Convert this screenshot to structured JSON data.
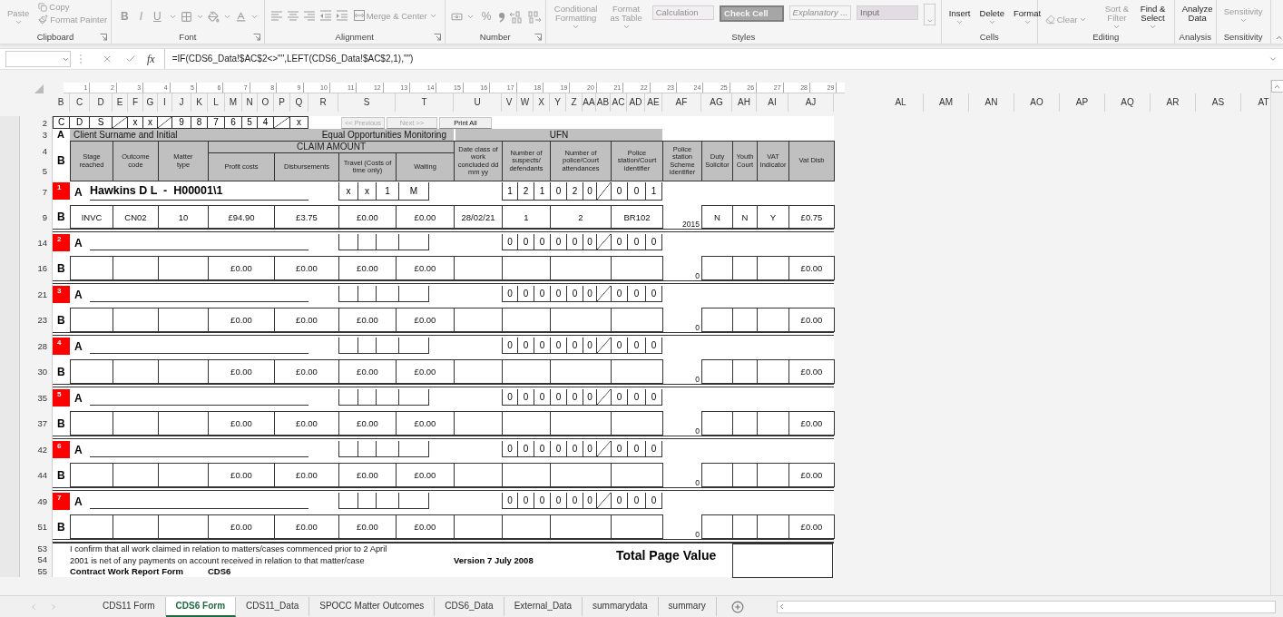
{
  "ribbon": {
    "groups": [
      {
        "kind": "clipboard",
        "label": "Clipboard",
        "buttons": [
          {
            "label": "Paste",
            "disabled": true
          },
          {
            "label": "Copy",
            "disabled": true
          },
          {
            "label": "Format Painter",
            "disabled": true
          }
        ]
      },
      {
        "kind": "font",
        "label": "Font",
        "buttons": [
          {
            "label": "B",
            "disabled": true
          },
          {
            "label": "I",
            "disabled": true
          },
          {
            "label": "U",
            "disabled": true
          }
        ]
      },
      {
        "kind": "alignment",
        "label": "Alignment",
        "buttons": [
          {
            "label": "Merge & Center",
            "disabled": true
          }
        ]
      },
      {
        "kind": "number",
        "label": "Number",
        "buttons": [
          {
            "label": "%",
            "disabled": true
          }
        ]
      },
      {
        "kind": "styles",
        "label": "Styles",
        "buttons": [
          {
            "label": "Conditional Formatting",
            "disabled": true
          },
          {
            "label": "Format as Table",
            "disabled": true
          }
        ],
        "styles": [
          {
            "label": "Calculation",
            "kind": "calc"
          },
          {
            "label": "Check Cell",
            "kind": "check"
          },
          {
            "label": "Explanatory ...",
            "kind": "note"
          },
          {
            "label": "Input",
            "kind": "input"
          }
        ]
      },
      {
        "kind": "cells",
        "label": "Cells",
        "buttons": [
          {
            "label": "Insert",
            "disabled": false
          },
          {
            "label": "Delete",
            "disabled": false
          },
          {
            "label": "Format",
            "disabled": false
          }
        ]
      },
      {
        "kind": "editing",
        "label": "Editing",
        "buttons": [
          {
            "label": "Clear",
            "disabled": true
          },
          {
            "label": "Sort & Filter",
            "disabled": true
          },
          {
            "label": "Find & Select",
            "disabled": false
          }
        ]
      },
      {
        "kind": "analysis",
        "label": "Analysis",
        "buttons": [
          {
            "label": "Analyze Data",
            "disabled": false
          }
        ]
      },
      {
        "kind": "sensitivity",
        "label": "Sensitivity",
        "buttons": [
          {
            "label": "Sensitivity",
            "disabled": true
          }
        ]
      }
    ]
  },
  "formula_bar": {
    "function_label": "fx",
    "formula": "=IF(CDS6_Data!$AC$2<>\"\",LEFT(CDS6_Data!$AC$2,1),\"\")"
  },
  "ruler": [
    "1",
    "2",
    "3",
    "4",
    "5",
    "6",
    "7",
    "8",
    "9",
    "10",
    "11",
    "12",
    "13",
    "14",
    "15",
    "16",
    "17",
    "18",
    "19",
    "20",
    "21",
    "22",
    "23",
    "24",
    "25",
    "26",
    "27",
    "28",
    "29"
  ],
  "columns": [
    "B",
    "C",
    "D",
    "E",
    "F",
    "G",
    "I",
    "J",
    "K",
    "L",
    "M",
    "N",
    "O",
    "P",
    "Q",
    "R",
    "S",
    "T",
    "U",
    "V",
    "W",
    "X",
    "Y",
    "Z",
    "AA",
    "AB",
    "AC",
    "AD",
    "AE",
    "AF",
    "AG",
    "AH",
    "AI",
    "AJ"
  ],
  "right_columns": [
    "AL",
    "AM",
    "AN",
    "AO",
    "AP",
    "AQ",
    "AR",
    "AS",
    "AT"
  ],
  "sheet": {
    "code_row": {
      "row": "2",
      "cells": [
        {
          "kind": "text",
          "text": "C"
        },
        {
          "kind": "text",
          "text": "D"
        },
        {
          "kind": "text",
          "text": "S"
        },
        {
          "kind": "slash"
        },
        {
          "kind": "text",
          "text": "x"
        },
        {
          "kind": "text",
          "text": "x"
        },
        {
          "kind": "slash"
        },
        {
          "kind": "text",
          "text": "9"
        },
        {
          "kind": "text",
          "text": "8"
        },
        {
          "kind": "text",
          "text": "7"
        },
        {
          "kind": "text",
          "text": "6"
        },
        {
          "kind": "text",
          "text": "5"
        },
        {
          "kind": "text",
          "text": "4"
        },
        {
          "kind": "slash"
        },
        {
          "kind": "text",
          "text": "x"
        }
      ],
      "buttons": [
        {
          "label": "<< Previous",
          "disabled": true
        },
        {
          "label": "Next >>",
          "disabled": true
        },
        {
          "label": "Print All",
          "disabled": false
        }
      ]
    },
    "band_row": {
      "row": "3",
      "label": "A",
      "client": "Client Surname and Initial",
      "monitoring": "Equal Opportunities Monitoring",
      "ufn": "UFN"
    },
    "header": {
      "rows": [
        "4",
        "5"
      ],
      "label": "B",
      "claim": "CLAIM AMOUNT",
      "columns": [
        "Stage reached",
        "Outcome code",
        "Matter type",
        "Profit costs",
        "Disbursements",
        "Travel (Costs of time only)",
        "Waiting",
        "Date class of work concluded dd mm yy",
        "Number of suspects/ defendants",
        "Number of police/Court attendances",
        "Police station/Court identifier",
        "Police station Scheme identifier",
        "Duty Solicitor",
        "Youth Court",
        "VAT Indicator",
        "Vat Disb"
      ]
    },
    "entries": [
      {
        "number": "1",
        "label_a": "A",
        "label_b": "B",
        "rows": [
          "7",
          "9"
        ],
        "name": "Hawkins D L  -  H00001\\1",
        "eo": [
          "x",
          "x",
          "1",
          "M"
        ],
        "ufn": [
          "1",
          "2",
          "1",
          "0",
          "2",
          "0",
          "0",
          "0",
          "1"
        ],
        "stage": "INVC",
        "outcome": "CN02",
        "matter": "10",
        "profit": "£94.90",
        "disbursements": "£3.75",
        "travel": "£0.00",
        "waiting": "£0.00",
        "date": "28/02/21",
        "suspects": "1",
        "attendances": "2",
        "police_station": "BR102",
        "scheme": "2015",
        "duty": "N",
        "youth": "N",
        "vat": "Y",
        "vat_disb": "£0.75"
      },
      {
        "number": "2",
        "label_a": "A",
        "label_b": "B",
        "rows": [
          "14",
          "16"
        ],
        "ufn": [
          "0",
          "0",
          "0",
          "0",
          "0",
          "0",
          "0",
          "0",
          "0"
        ],
        "profit": "£0.00",
        "disbursements": "£0.00",
        "travel": "£0.00",
        "waiting": "£0.00",
        "scheme": "0",
        "vat_disb": "£0.00"
      },
      {
        "number": "3",
        "label_a": "A",
        "label_b": "B",
        "rows": [
          "21",
          "23"
        ],
        "ufn": [
          "0",
          "0",
          "0",
          "0",
          "0",
          "0",
          "0",
          "0",
          "0"
        ],
        "profit": "£0.00",
        "disbursements": "£0.00",
        "travel": "£0.00",
        "waiting": "£0.00",
        "scheme": "0",
        "vat_disb": "£0.00"
      },
      {
        "number": "4",
        "label_a": "A",
        "label_b": "B",
        "rows": [
          "28",
          "30"
        ],
        "ufn": [
          "0",
          "0",
          "0",
          "0",
          "0",
          "0",
          "0",
          "0",
          "0"
        ],
        "profit": "£0.00",
        "disbursements": "£0.00",
        "travel": "£0.00",
        "waiting": "£0.00",
        "scheme": "0",
        "vat_disb": "£0.00"
      },
      {
        "number": "5",
        "label_a": "A",
        "label_b": "B",
        "rows": [
          "35",
          "37"
        ],
        "ufn": [
          "0",
          "0",
          "0",
          "0",
          "0",
          "0",
          "0",
          "0",
          "0"
        ],
        "profit": "£0.00",
        "disbursements": "£0.00",
        "travel": "£0.00",
        "waiting": "£0.00",
        "scheme": "0",
        "vat_disb": "£0.00"
      },
      {
        "number": "6",
        "label_a": "A",
        "label_b": "B",
        "rows": [
          "42",
          "44"
        ],
        "ufn": [
          "0",
          "0",
          "0",
          "0",
          "0",
          "0",
          "0",
          "0",
          "0"
        ],
        "profit": "£0.00",
        "disbursements": "£0.00",
        "travel": "£0.00",
        "waiting": "£0.00",
        "scheme": "0",
        "vat_disb": "£0.00"
      },
      {
        "number": "7",
        "label_a": "A",
        "label_b": "B",
        "rows": [
          "49",
          "51"
        ],
        "ufn": [
          "0",
          "0",
          "0",
          "0",
          "0",
          "0",
          "0",
          "0",
          "0"
        ],
        "profit": "£0.00",
        "disbursements": "£0.00",
        "travel": "£0.00",
        "waiting": "£0.00",
        "scheme": "0",
        "vat_disb": "£0.00"
      }
    ],
    "footer": {
      "rows": [
        "53",
        "54",
        "55"
      ],
      "confirm": "I confirm that all work claimed in relation to matters/cases commenced prior to 2 April 2001 is net of any payments on account received in relation to that matter/case",
      "version": "Version 7 July 2008",
      "total_label": "Total Page Value",
      "form_label": "Contract Work Report Form",
      "form_code": "CDS6"
    }
  },
  "tabs": [
    {
      "label": "CDS11 Form",
      "selected": false
    },
    {
      "label": "CDS6 Form",
      "selected": true
    },
    {
      "label": "CDS11_Data",
      "selected": false
    },
    {
      "label": "SPOCC Matter Outcomes",
      "selected": false
    },
    {
      "label": "CDS6_Data",
      "selected": false
    },
    {
      "label": "External_Data",
      "selected": false
    },
    {
      "label": "summarydata",
      "selected": false
    },
    {
      "label": "summary",
      "selected": false
    }
  ]
}
